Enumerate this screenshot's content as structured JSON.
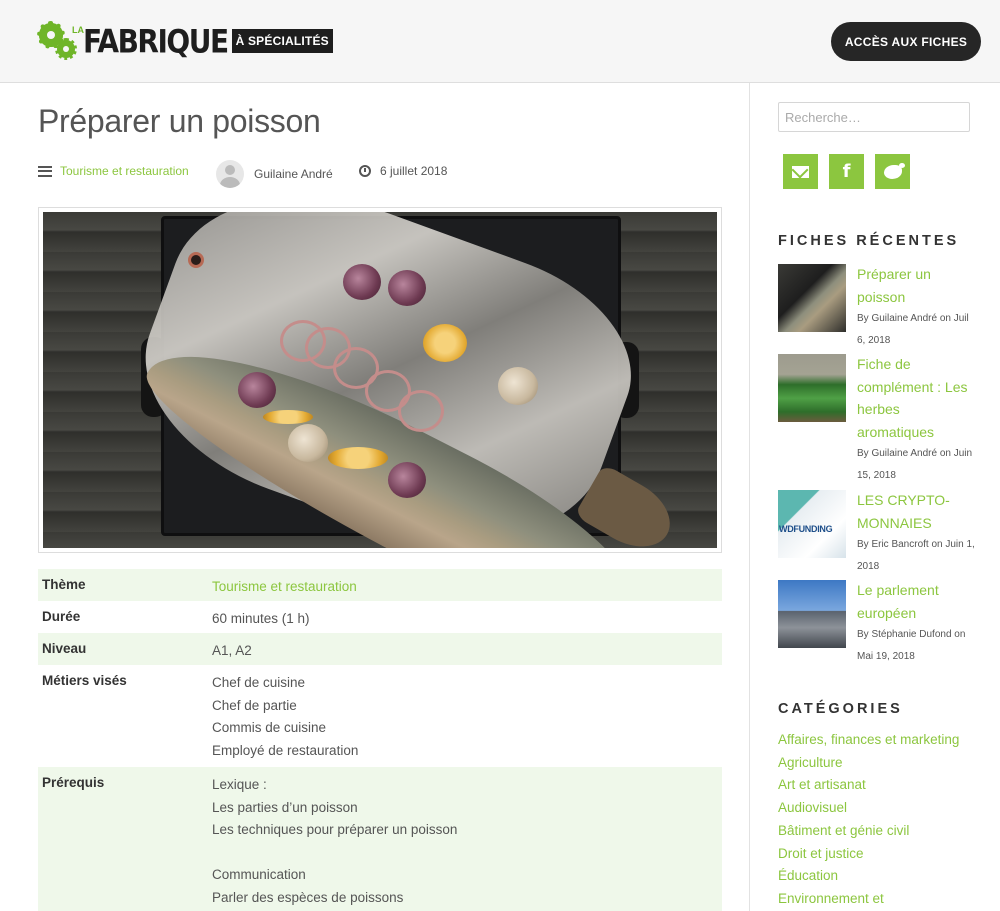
{
  "header": {
    "logo_la": "LA",
    "logo_main": "FABRIQUE",
    "logo_sub": "À SPÉCIALITÉS",
    "cta_label": "ACCÈS AUX FICHES"
  },
  "post": {
    "title": "Préparer un poisson",
    "category": "Tourisme et restauration",
    "author": "Guilaine André",
    "date": "6 juillet 2018"
  },
  "info_table": {
    "theme_label": "Thème",
    "theme_value": "Tourisme et restauration",
    "duree_label": "Durée",
    "duree_value": "60 minutes (1 h)",
    "niveau_label": "Niveau",
    "niveau_value": "A1, A2",
    "metiers_label": "Métiers visés",
    "metiers": [
      "Chef de cuisine",
      "Chef de partie",
      "Commis de cuisine",
      "Employé de restauration"
    ],
    "prerequis_label": "Prérequis",
    "prerequis": [
      "Lexique :",
      "Les parties d’un poisson",
      "Les techniques pour préparer un poisson",
      "",
      "Communication",
      "Parler des espèces de poissons"
    ]
  },
  "sidebar": {
    "search_placeholder": "Recherche…",
    "social": [
      {
        "name": "email-icon"
      },
      {
        "name": "facebook-icon",
        "glyph": "f"
      },
      {
        "name": "twitter-icon"
      }
    ],
    "recent_title": "FICHES RÉCENTES",
    "recent_posts": [
      {
        "title": "Préparer un poisson",
        "meta": "By Guilaine André on Juil 6, 2018"
      },
      {
        "title": "Fiche de complément : Les herbes aromatiques",
        "meta": "By Guilaine André on Juin 15, 2018"
      },
      {
        "title": "LES CRYPTO-MONNAIES",
        "meta": "By Eric Bancroft on Juin 1, 2018",
        "thumb_text": "WDFUNDING"
      },
      {
        "title": "Le parlement européen",
        "meta": "By Stéphanie Dufond on Mai 19, 2018"
      }
    ],
    "categories_title": "CATÉGORIES",
    "categories": [
      "Affaires, finances et marketing",
      "Agriculture",
      "Art et artisanat",
      "Audiovisuel",
      "Bâtiment et génie civil",
      "Droit et justice",
      "Éducation",
      "Environnement et"
    ]
  },
  "colors": {
    "accent": "#8cc63f",
    "dark": "#262626",
    "row_alt": "#eff8ea"
  }
}
